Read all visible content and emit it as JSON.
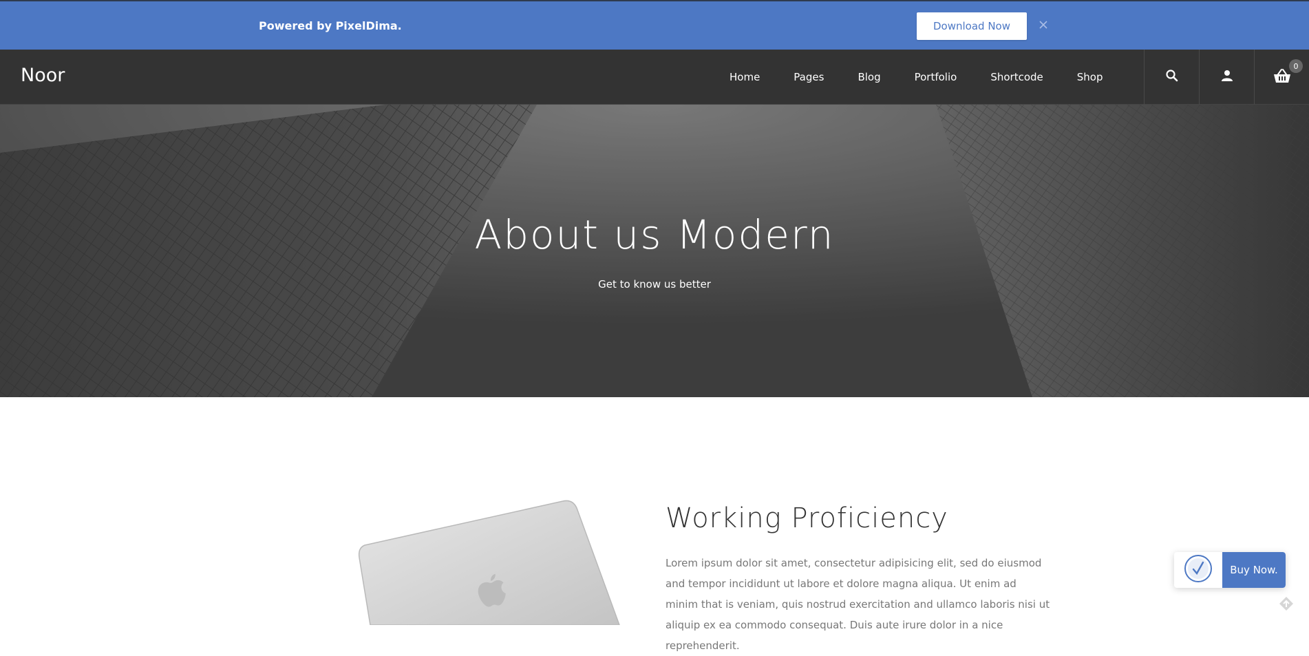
{
  "promo": {
    "text": "Powered by PixelDima.",
    "button_label": "Download Now",
    "close_icon": "close-icon",
    "background_color": "#4d78c4"
  },
  "header": {
    "logo": "Noor",
    "nav": [
      "Home",
      "Pages",
      "Blog",
      "Portfolio",
      "Shortcode",
      "Shop"
    ],
    "icons": [
      "search-icon",
      "user-icon",
      "basket-icon"
    ],
    "cart_count": "0"
  },
  "hero": {
    "title": "About us Modern",
    "subtitle": "Get to know us better"
  },
  "section": {
    "title": "Working Proficiency",
    "body": "Lorem ipsum dolor sit amet, consectetur adipisicing elit, sed do eiusmod and tempor incididunt ut labore et dolore magna aliqua. Ut enim ad minim that is veniam, quis nostrud exercitation and ullamco laboris nisi ut aliquip ex ea commodo consequat. Duis aute irure dolor in a nice reprehenderit."
  },
  "buy_widget": {
    "label": "Buy Now.",
    "accent_color": "#4d78c4"
  }
}
